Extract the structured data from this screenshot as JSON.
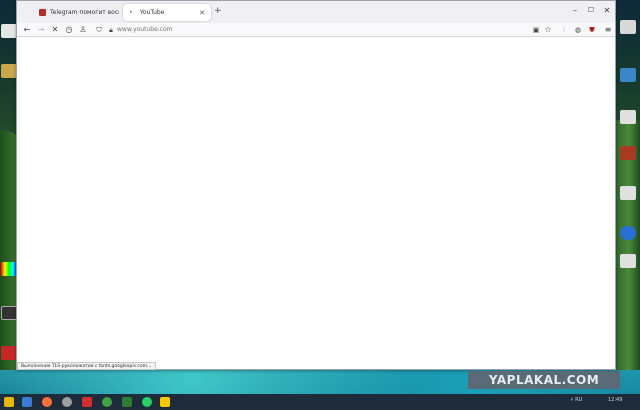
{
  "browser": {
    "tabs": [
      {
        "title": "Telegram помогит воскрешать…",
        "active": false,
        "favicon_color": "#b03030"
      },
      {
        "title": "YouTube",
        "active": true,
        "favicon_color": "#ff0000"
      }
    ],
    "new_tab_label": "+",
    "address": {
      "value": "",
      "placeholder": "www.youtube.com"
    },
    "status_text": "Выполнение TLS-рукопожатия с fonts.googleapis.com…",
    "window_controls": {
      "minimize": "–",
      "maximize": "☐",
      "close": "✕"
    }
  },
  "watermark": {
    "text": "YAPLAKAL.COM"
  },
  "taskbar": {
    "clock": "12:49",
    "tray_text": "⚡ RU"
  },
  "colors": {
    "tabbar_bg": "#f0f0f4",
    "toolbar_bg": "#f9f9fb",
    "taskbar_bg": "#1d2b3a",
    "watermark_bg": "#5a6b78"
  }
}
